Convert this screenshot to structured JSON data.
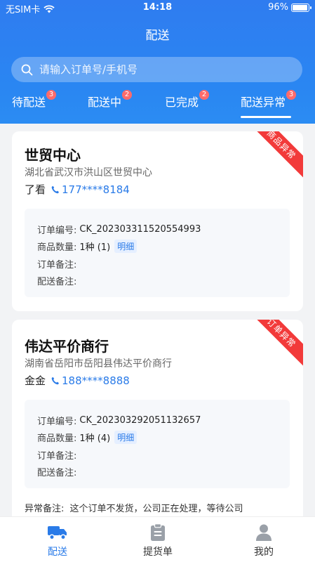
{
  "status_bar": {
    "carrier": "无SIM卡",
    "time": "14:18",
    "battery": "96%",
    "battery_level": 0.96
  },
  "header": {
    "title": "配送"
  },
  "search": {
    "placeholder": "请输入订单号/手机号"
  },
  "tabs": [
    {
      "label": "待配送",
      "badge": "3"
    },
    {
      "label": "配送中",
      "badge": "2"
    },
    {
      "label": "已完成",
      "badge": "2"
    },
    {
      "label": "配送异常",
      "badge": "3",
      "active": true
    }
  ],
  "orders": [
    {
      "ribbon": "商品异常",
      "shop": "世贸中心",
      "address": "湖北省武汉市洪山区世贸中心",
      "contact_name": "了看",
      "phone": "177****8184",
      "order_no_label": "订单编号:",
      "order_no": "CK_202303311520554993",
      "qty_label": "商品数量:",
      "qty": "1种 (1)",
      "detail": "明细",
      "order_note_label": "订单备注:",
      "delivery_note_label": "配送备注:"
    },
    {
      "ribbon": "订单异常",
      "shop": "伟达平价商行",
      "address": "湖南省岳阳市岳阳县伟达平价商行",
      "contact_name": "金金",
      "phone": "188****8888",
      "order_no_label": "订单编号:",
      "order_no": "CK_202303292051132657",
      "qty_label": "商品数量:",
      "qty": "1种 (4)",
      "detail": "明细",
      "order_note_label": "订单备注:",
      "delivery_note_label": "配送备注:",
      "exception_label": "异常备注:",
      "exception_text": "这个订单不发货，公司正在处理，等待公司"
    }
  ],
  "tabbar": [
    {
      "label": "配送",
      "icon": "truck-icon",
      "active": true
    },
    {
      "label": "提货单",
      "icon": "clipboard-icon"
    },
    {
      "label": "我的",
      "icon": "user-icon"
    }
  ],
  "colors": {
    "primary": "#2a7be8",
    "ribbon": "#f23a3a",
    "badge": "#ff6b6b"
  }
}
